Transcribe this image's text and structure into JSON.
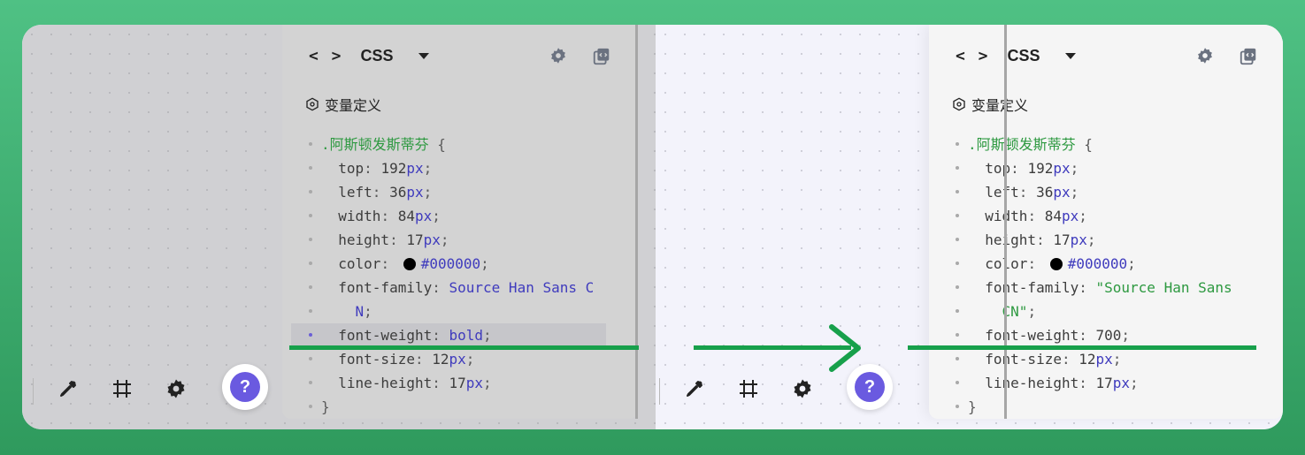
{
  "panel": {
    "language": "CSS",
    "code_icon": "< >",
    "variables_label": "变量定义"
  },
  "before": {
    "lines": [
      {
        "type": "selector",
        "text": ".阿斯顿发斯蒂芬 {"
      },
      {
        "type": "prop",
        "prop": "top",
        "num": "192",
        "unit": "px"
      },
      {
        "type": "prop",
        "prop": "left",
        "num": "36",
        "unit": "px"
      },
      {
        "type": "prop",
        "prop": "width",
        "num": "84",
        "unit": "px"
      },
      {
        "type": "prop",
        "prop": "height",
        "num": "17",
        "unit": "px"
      },
      {
        "type": "color",
        "prop": "color",
        "value": "#000000"
      },
      {
        "type": "text",
        "prop": "font-family",
        "value": "Source Han Sans C",
        "cls": "val"
      },
      {
        "type": "cont",
        "value": "N",
        "cls": "val"
      },
      {
        "type": "text",
        "prop": "font-weight",
        "value": "bold",
        "cls": "val",
        "highlight": true
      },
      {
        "type": "prop",
        "prop": "font-size",
        "num": "12",
        "unit": "px"
      },
      {
        "type": "prop",
        "prop": "line-height",
        "num": "17",
        "unit": "px"
      },
      {
        "type": "close",
        "text": "}"
      }
    ]
  },
  "after": {
    "lines": [
      {
        "type": "selector",
        "text": ".阿斯顿发斯蒂芬 {"
      },
      {
        "type": "prop",
        "prop": "top",
        "num": "192",
        "unit": "px"
      },
      {
        "type": "prop",
        "prop": "left",
        "num": "36",
        "unit": "px"
      },
      {
        "type": "prop",
        "prop": "width",
        "num": "84",
        "unit": "px"
      },
      {
        "type": "prop",
        "prop": "height",
        "num": "17",
        "unit": "px"
      },
      {
        "type": "color",
        "prop": "color",
        "value": "#000000"
      },
      {
        "type": "text",
        "prop": "font-family",
        "value": "\"Source Han Sans",
        "cls": "str"
      },
      {
        "type": "cont",
        "value": "CN\"",
        "cls": "str"
      },
      {
        "type": "text",
        "prop": "font-weight",
        "value": "700",
        "cls": "num"
      },
      {
        "type": "prop",
        "prop": "font-size",
        "num": "12",
        "unit": "px"
      },
      {
        "type": "prop",
        "prop": "line-height",
        "num": "17",
        "unit": "px"
      },
      {
        "type": "close",
        "text": "}"
      }
    ]
  },
  "help": {
    "label": "?"
  },
  "colors": {
    "accent": "#6a5ae0",
    "green": "#17a04b"
  }
}
